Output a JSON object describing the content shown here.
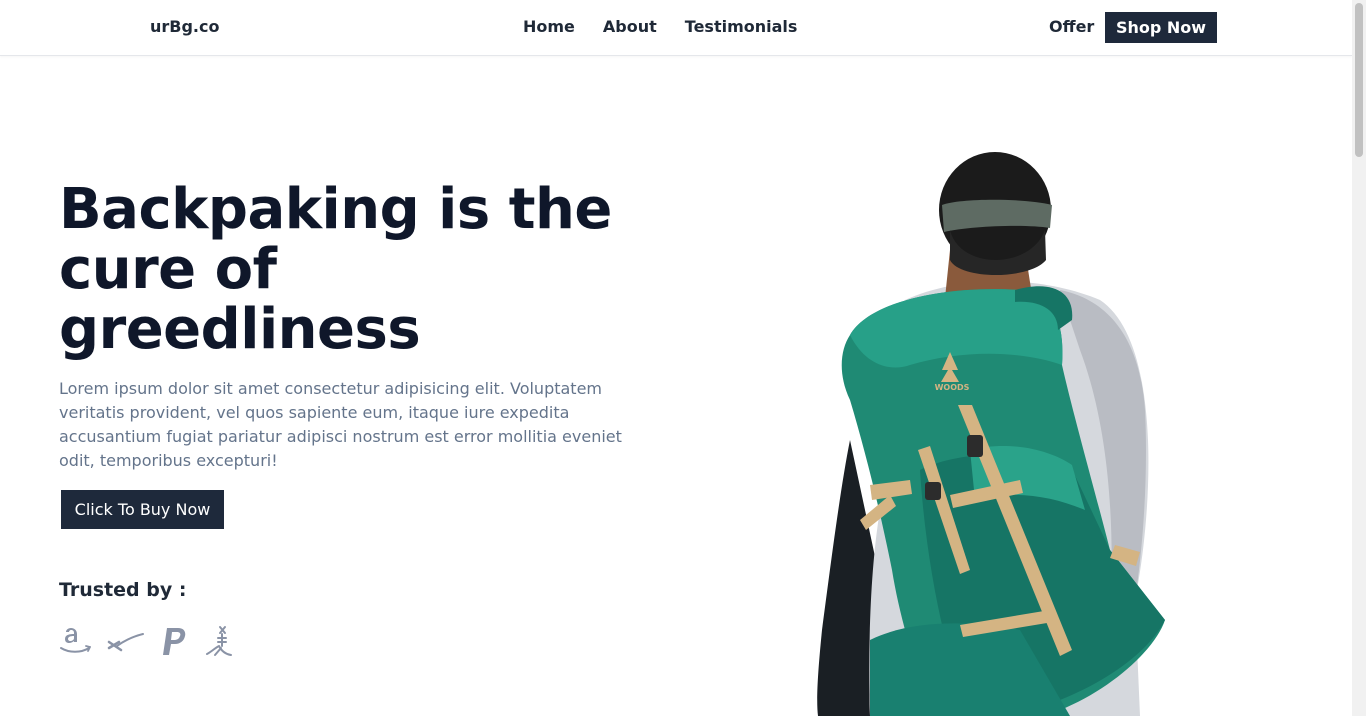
{
  "nav": {
    "logo": "urBg.co",
    "links": [
      "Home",
      "About",
      "Testimonials"
    ],
    "offer": "Offer",
    "shop_button": "Shop Now"
  },
  "hero": {
    "headline": "Backpaking is the cure of greedliness",
    "description": "Lorem ipsum dolor sit amet consectetur adipisicing elit. Voluptatem veritatis provident, vel quos sapiente eum, itaque iure expedita accusantium fugiat pariatur adipisci nostrum est error mollitia eveniet odit, temporibus excepturi!",
    "cta": "Click To Buy Now",
    "backpack_logo": "WOODS"
  },
  "trusted": {
    "label": "Trusted by :",
    "brands": [
      "amazon-logo-icon",
      "starlink-logo-icon",
      "paypal-logo-icon",
      "xbox-logo-icon"
    ]
  },
  "colors": {
    "primary_dark": "#1e293b",
    "heading": "#0f172a",
    "muted_text": "#64748b",
    "backpack_teal": "#1f8a74",
    "strap_tan": "#d4b483"
  }
}
